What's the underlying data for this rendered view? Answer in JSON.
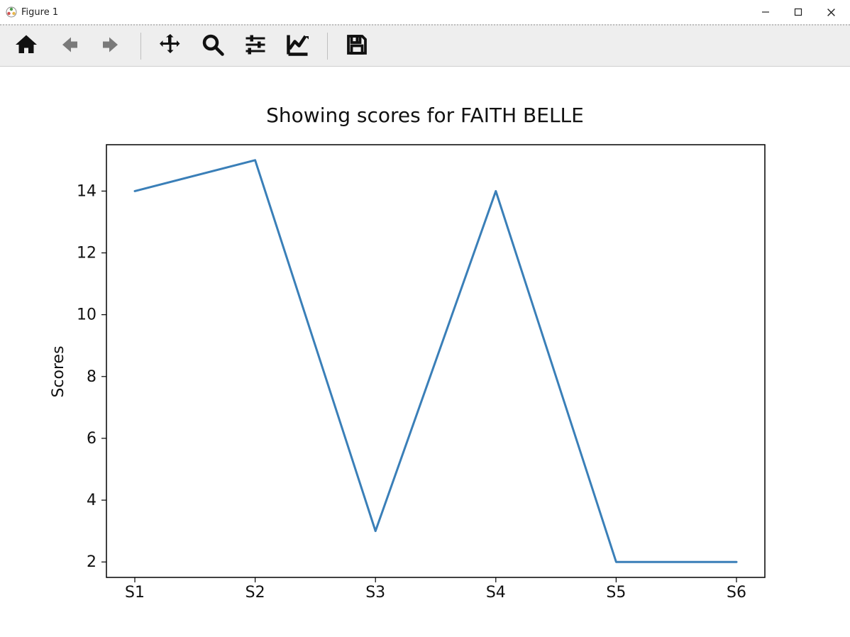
{
  "window": {
    "title": "Figure 1"
  },
  "toolbar": {
    "home": "Home",
    "back": "Back",
    "forward": "Forward",
    "pan": "Pan",
    "zoom": "Zoom",
    "subplots": "Subplots",
    "axes": "Axes",
    "save": "Save"
  },
  "chart_data": {
    "type": "line",
    "title": "Showing scores for FAITH BELLE",
    "xlabel": "",
    "ylabel": "Scores",
    "categories": [
      "S1",
      "S2",
      "S3",
      "S4",
      "S5",
      "S6"
    ],
    "values": [
      14,
      15,
      3,
      14,
      2,
      2
    ],
    "y_ticks": [
      2,
      4,
      6,
      8,
      10,
      12,
      14
    ],
    "ylim": [
      1.5,
      15.5
    ],
    "line_color": "#3a7fb8"
  }
}
